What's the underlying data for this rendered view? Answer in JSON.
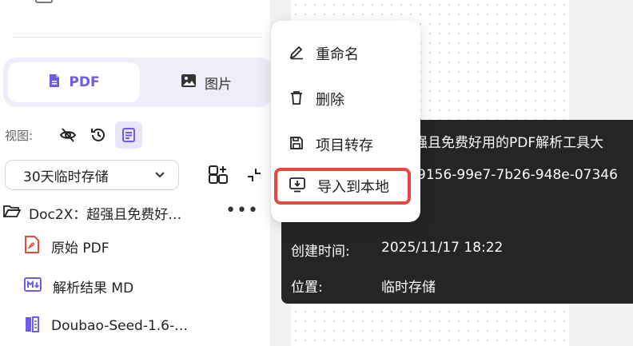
{
  "sidebar": {
    "tabs": [
      {
        "label": "PDF",
        "active": true
      },
      {
        "label": "图片",
        "active": false
      }
    ],
    "view_label": "视图:",
    "storage_select": {
      "value": "30天临时存储"
    },
    "tree": {
      "folder": {
        "name": "Doc2X：超强且免费好…",
        "more": "•••"
      },
      "items": [
        {
          "label": "原始 PDF",
          "icon": "pdf-file-icon"
        },
        {
          "label": "解析结果 MD",
          "icon": "markdown-file-icon"
        },
        {
          "label": "Doubao-Seed-1.6-…",
          "icon": "translate-book-icon"
        }
      ]
    }
  },
  "context_menu": {
    "items": [
      {
        "label": "重命名",
        "icon": "pencil-icon"
      },
      {
        "label": "删除",
        "icon": "trash-icon"
      },
      {
        "label": "项目转存",
        "icon": "save-icon"
      },
      {
        "label": "导入到本地",
        "icon": "download-icon",
        "highlighted": true
      }
    ]
  },
  "tooltip": {
    "title_partial": "强且免费好用的PDF解析工具大",
    "id_partial": "9156-99e7-7b26-948e-07346",
    "created_label": "创建时间:",
    "created_value": "2025/11/17 18:22",
    "location_label": "位置:",
    "location_value": "临时存储"
  },
  "colors": {
    "accent": "#6c5ce7",
    "highlight_border": "#e5483f",
    "tooltip_bg": "#252525",
    "pdf_red": "#e5483f"
  }
}
